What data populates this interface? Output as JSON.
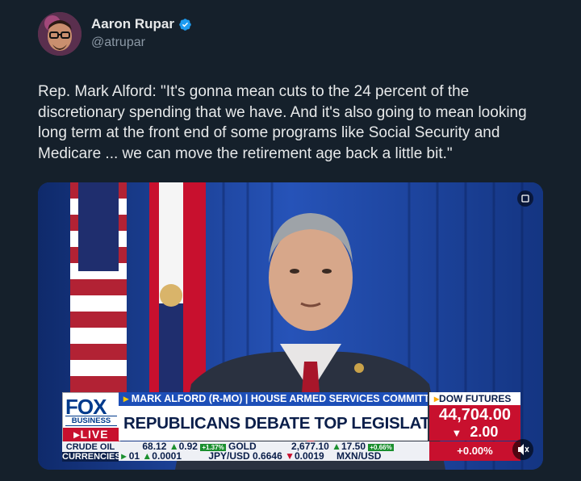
{
  "author": {
    "display_name": "Aaron Rupar",
    "handle": "@atrupar",
    "verified_icon": "verified-badge-icon"
  },
  "tweet": {
    "text": "Rep. Mark Alford: \"It's gonna mean cuts to the 24 percent of the discretionary spending that we have. And it's also going to mean looking long term at the front end of some programs like Social Security and Medicare ... we can move the retirement age back a little bit.\""
  },
  "video": {
    "chyron_network": "FOX",
    "chyron_business": "BUSINESS",
    "chyron_live": "LIVE",
    "chyron_nameplate": "MARK ALFORD (R-MO) | HOUSE ARMED SERVICES COMMITTEE",
    "chyron_headline": "REPUBLICANS DEBATE TOP LEGISLATIVE PRIORITIES",
    "dow_label": "DOW FUTURES",
    "dow_value": "44,704.00",
    "dow_change": "2.00",
    "ticker_row1": [
      {
        "label": "CRUDE OIL",
        "value": "68.12",
        "change": "0.92",
        "pct": "+1.37%"
      },
      {
        "label": "GOLD",
        "value": "2,677.10",
        "change": "17.50",
        "pct": "+0.66%"
      }
    ],
    "ticker_row2": [
      {
        "label": "CURRENCIES",
        "value": "01",
        "change": "0.0001"
      },
      {
        "label": "JPY/USD",
        "value": "0.6646",
        "change": "0.0019"
      },
      {
        "label": "MXN/USD",
        "value": ""
      }
    ],
    "zero_pct": "+0.00%"
  },
  "colors": {
    "background": "#15202b",
    "text": "#e7e9ea",
    "secondary": "#8b98a5",
    "verified": "#1d9bf0",
    "fox_blue": "#1d4fb8",
    "fox_red": "#c8102e"
  }
}
